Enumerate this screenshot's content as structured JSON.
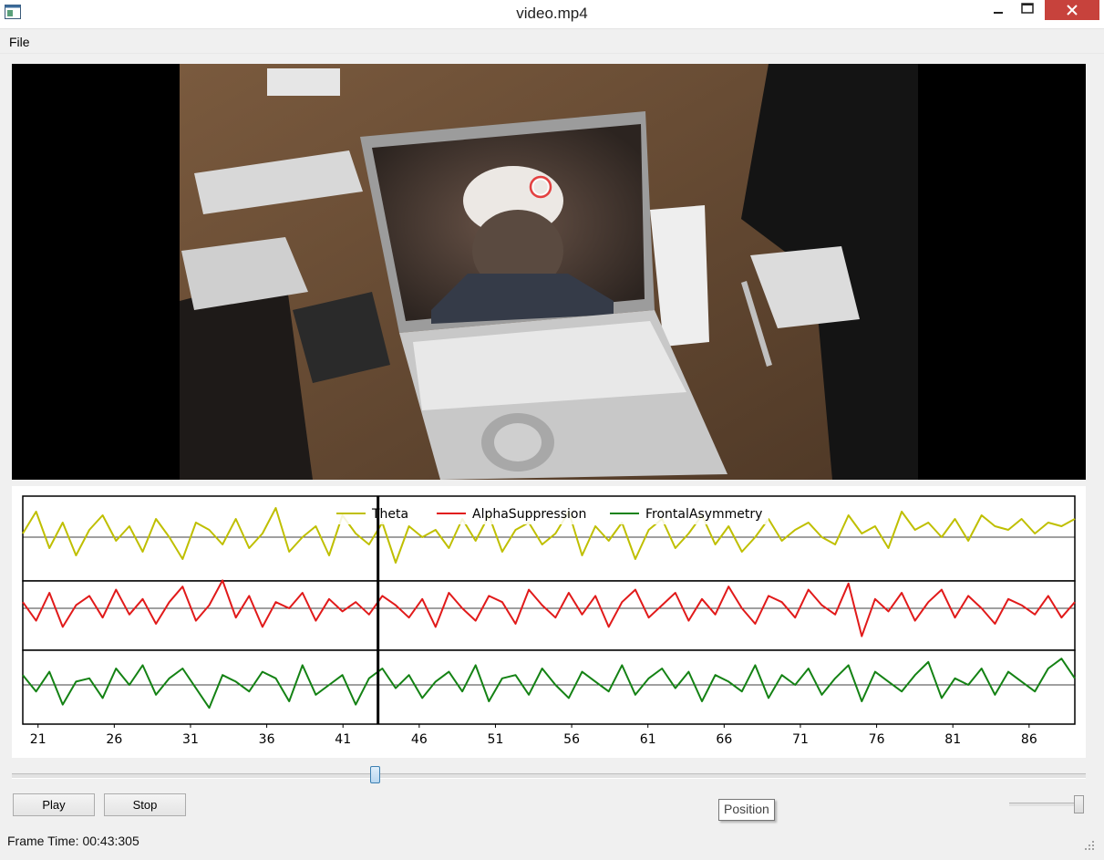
{
  "window": {
    "title": "video.mp4"
  },
  "menu": {
    "file_label": "File"
  },
  "icons": {
    "app": "app-window-icon",
    "minimize": "minimize-icon",
    "maximize": "maximize-icon",
    "close": "close-icon",
    "gaze_marker": "gaze-marker-icon",
    "grip": "resize-grip-icon"
  },
  "video": {
    "description_colors": {
      "background": "#000000"
    }
  },
  "chart_data": {
    "type": "line",
    "legend_position": "top-center",
    "legend": [
      {
        "name": "Theta",
        "color": "#bfbf00"
      },
      {
        "name": "AlphaSuppression",
        "color": "#e11a1a"
      },
      {
        "name": "FrontalAsymmetry",
        "color": "#148214"
      }
    ],
    "x_ticks": [
      "21",
      "26",
      "31",
      "36",
      "41",
      "46",
      "51",
      "56",
      "61",
      "66",
      "71",
      "76",
      "81",
      "86"
    ],
    "xlim": [
      20,
      89
    ],
    "cursor_x": 43.3,
    "grid": false,
    "series": [
      {
        "name": "Theta",
        "color": "#bfbf00",
        "values": [
          0.1,
          0.7,
          -0.3,
          0.4,
          -0.5,
          0.2,
          0.6,
          -0.1,
          0.3,
          -0.4,
          0.5,
          0.0,
          -0.6,
          0.4,
          0.2,
          -0.2,
          0.5,
          -0.3,
          0.1,
          0.8,
          -0.4,
          0.0,
          0.3,
          -0.5,
          0.6,
          0.1,
          -0.2,
          0.4,
          -0.7,
          0.3,
          0.0,
          0.2,
          -0.3,
          0.5,
          -0.1,
          0.6,
          -0.4,
          0.2,
          0.4,
          -0.2,
          0.1,
          0.7,
          -0.5,
          0.3,
          -0.1,
          0.4,
          -0.6,
          0.2,
          0.5,
          -0.3,
          0.1,
          0.6,
          -0.2,
          0.3,
          -0.4,
          0.0,
          0.5,
          -0.1,
          0.2,
          0.4,
          0.0,
          -0.2,
          0.6,
          0.1,
          0.3,
          -0.3,
          0.7,
          0.2,
          0.4,
          0.0,
          0.5,
          -0.1,
          0.6,
          0.3,
          0.2,
          0.5,
          0.1,
          0.4,
          0.3,
          0.5
        ]
      },
      {
        "name": "AlphaSuppression",
        "color": "#e11a1a",
        "values": [
          0.2,
          -0.4,
          0.5,
          -0.6,
          0.1,
          0.4,
          -0.3,
          0.6,
          -0.2,
          0.3,
          -0.5,
          0.2,
          0.7,
          -0.4,
          0.1,
          0.9,
          -0.3,
          0.4,
          -0.6,
          0.2,
          0.0,
          0.5,
          -0.4,
          0.3,
          -0.1,
          0.2,
          -0.2,
          0.4,
          0.1,
          -0.3,
          0.3,
          -0.6,
          0.5,
          0.0,
          -0.4,
          0.4,
          0.2,
          -0.5,
          0.6,
          0.1,
          -0.3,
          0.5,
          -0.2,
          0.4,
          -0.6,
          0.2,
          0.6,
          -0.3,
          0.1,
          0.5,
          -0.4,
          0.3,
          -0.2,
          0.7,
          0.0,
          -0.5,
          0.4,
          0.2,
          -0.3,
          0.6,
          0.1,
          -0.2,
          0.8,
          -0.9,
          0.3,
          -0.1,
          0.5,
          -0.4,
          0.2,
          0.6,
          -0.3,
          0.4,
          0.0,
          -0.5,
          0.3,
          0.1,
          -0.2,
          0.4,
          -0.3,
          0.2
        ]
      },
      {
        "name": "FrontalAsymmetry",
        "color": "#148214",
        "values": [
          0.3,
          -0.2,
          0.4,
          -0.6,
          0.1,
          0.2,
          -0.4,
          0.5,
          0.0,
          0.6,
          -0.3,
          0.2,
          0.5,
          -0.1,
          -0.7,
          0.3,
          0.1,
          -0.2,
          0.4,
          0.2,
          -0.5,
          0.6,
          -0.3,
          0.0,
          0.3,
          -0.6,
          0.2,
          0.5,
          -0.1,
          0.3,
          -0.4,
          0.1,
          0.4,
          -0.2,
          0.6,
          -0.5,
          0.2,
          0.3,
          -0.3,
          0.5,
          0.0,
          -0.4,
          0.4,
          0.1,
          -0.2,
          0.6,
          -0.3,
          0.2,
          0.5,
          -0.1,
          0.4,
          -0.5,
          0.3,
          0.1,
          -0.2,
          0.6,
          -0.4,
          0.3,
          0.0,
          0.5,
          -0.3,
          0.2,
          0.6,
          -0.5,
          0.4,
          0.1,
          -0.2,
          0.3,
          0.7,
          -0.4,
          0.2,
          0.0,
          0.5,
          -0.3,
          0.4,
          0.1,
          -0.2,
          0.5,
          0.8,
          0.2
        ]
      }
    ]
  },
  "controls": {
    "play_label": "Play",
    "stop_label": "Stop",
    "position_tooltip": "Position",
    "position_fraction": 0.339,
    "volume_fraction": 1.0
  },
  "status": {
    "frame_time": "Frame Time: 00:43:305"
  }
}
